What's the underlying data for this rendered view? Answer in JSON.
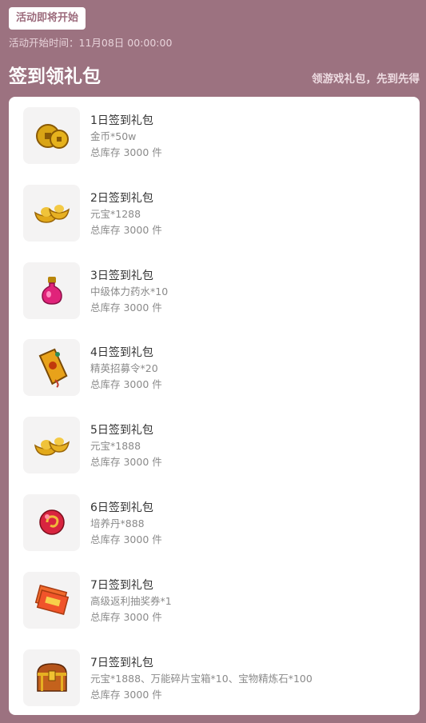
{
  "header": {
    "status_label": "活动即将开始",
    "start_time": "活动开始时间：11月08日 00:00:00"
  },
  "section": {
    "title": "签到领礼包",
    "subtitle": "领游戏礼包，先到先得"
  },
  "gifts": [
    {
      "title": "1日签到礼包",
      "desc": "金币*50w",
      "stock": "总库存 3000 件",
      "icon": "gold-coins"
    },
    {
      "title": "2日签到礼包",
      "desc": "元宝*1288",
      "stock": "总库存 3000 件",
      "icon": "gold-ingot"
    },
    {
      "title": "3日签到礼包",
      "desc": "中级体力药水*10",
      "stock": "总库存 3000 件",
      "icon": "potion"
    },
    {
      "title": "4日签到礼包",
      "desc": "精英招募令*20",
      "stock": "总库存 3000 件",
      "icon": "recruit-token"
    },
    {
      "title": "5日签到礼包",
      "desc": "元宝*1888",
      "stock": "总库存 3000 件",
      "icon": "gold-ingot"
    },
    {
      "title": "6日签到礼包",
      "desc": "培养丹*888",
      "stock": "总库存 3000 件",
      "icon": "pill-orb"
    },
    {
      "title": "7日签到礼包",
      "desc": "高级返利抽奖券*1",
      "stock": "总库存 3000 件",
      "icon": "lottery-ticket"
    },
    {
      "title": "7日签到礼包",
      "desc": "元宝*1888、万能碎片宝箱*10、宝物精炼石*100",
      "stock": "总库存 3000 件",
      "icon": "treasure-chest"
    }
  ],
  "colors": {
    "background": "#9c7280",
    "card": "#ffffff",
    "chip_text": "#9c6b7c"
  }
}
